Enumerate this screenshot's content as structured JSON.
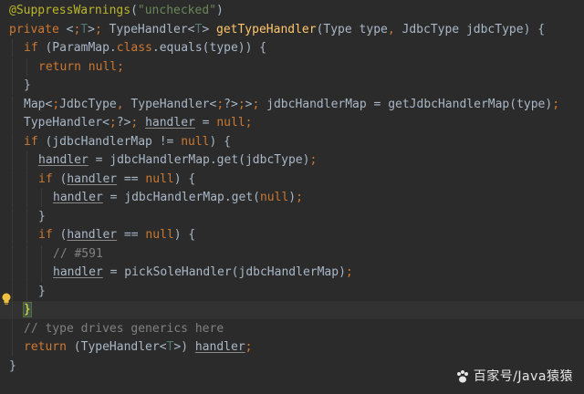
{
  "editor": {
    "lines": [
      "@SuppressWarnings(\"unchecked\")",
      "private <T> TypeHandler<T> getTypeHandler(Type type, JdbcType jdbcType) {",
      "  if (ParamMap.class.equals(type)) {",
      "    return null;",
      "  }",
      "  Map<JdbcType, TypeHandler<?>> jdbcHandlerMap = getJdbcHandlerMap(type);",
      "  TypeHandler<?> handler = null;",
      "  if (jdbcHandlerMap != null) {",
      "    handler = jdbcHandlerMap.get(jdbcType);",
      "    if (handler == null) {",
      "      handler = jdbcHandlerMap.get(null);",
      "    }",
      "    if (handler == null) {",
      "      // #591",
      "      handler = pickSoleHandler(jdbcHandlerMap);",
      "    }",
      "  }",
      "  // type drives generics here",
      "  return (TypeHandler<T>) handler;",
      "}"
    ],
    "current_line": 16,
    "intention_icon": "lightbulb-icon"
  },
  "watermark": {
    "text": "百家号/Java猿猿",
    "icon": "paw-icon"
  },
  "colors": {
    "background": "#2b2b2b",
    "keyword": "#cc7832",
    "annotation": "#bbb529",
    "string": "#6a8759",
    "method": "#ffc66d",
    "comment": "#808080",
    "text": "#a9b7c6"
  }
}
